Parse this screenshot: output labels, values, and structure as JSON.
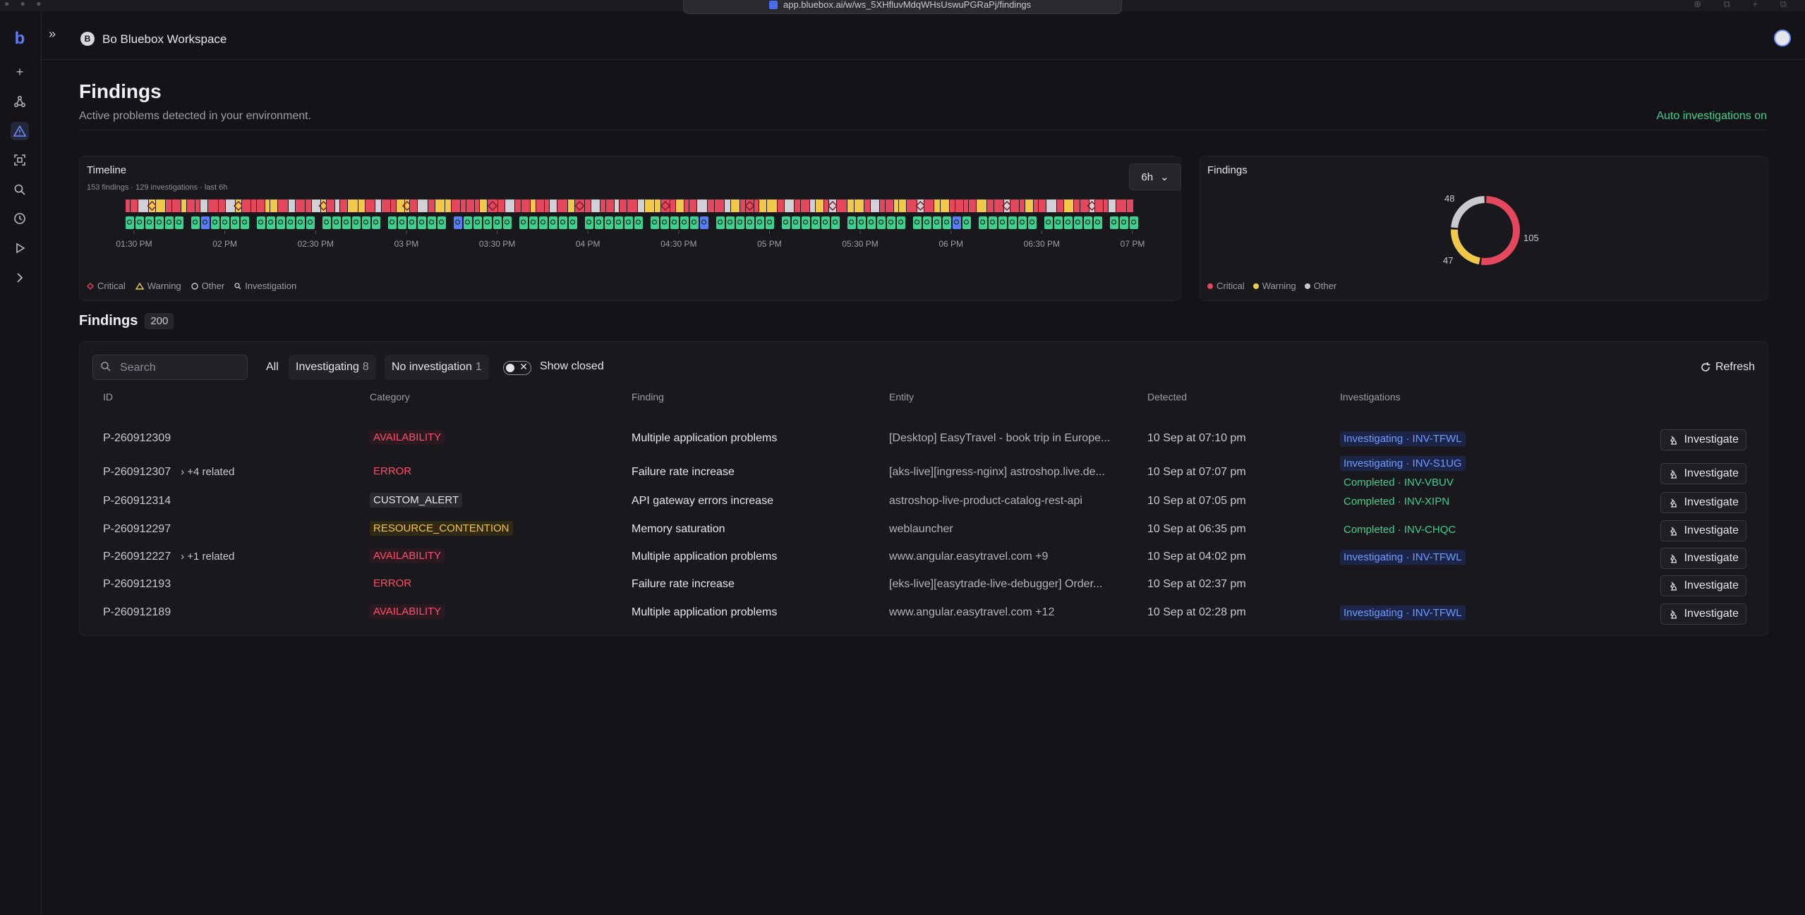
{
  "browser": {
    "url": "app.bluebox.ai/w/ws_5XHfluvMdqWHsUswuPGRaPj/findings"
  },
  "sidebar": {
    "items": [
      {
        "name": "logo",
        "icon": "bluebox-logo"
      },
      {
        "name": "new",
        "icon": "plus-icon"
      },
      {
        "name": "topology",
        "icon": "graph-icon"
      },
      {
        "name": "findings",
        "icon": "alert-triangle-icon",
        "active": true
      },
      {
        "name": "entities",
        "icon": "scan-icon"
      },
      {
        "name": "search",
        "icon": "search-icon"
      },
      {
        "name": "history",
        "icon": "clock-icon"
      },
      {
        "name": "runs",
        "icon": "play-icon"
      },
      {
        "name": "terminal",
        "icon": "chevron-right-icon"
      }
    ]
  },
  "header": {
    "workspace_initial": "B",
    "workspace_name": "Bo Bluebox Workspace"
  },
  "page": {
    "title": "Findings",
    "subtitle": "Active problems detected in your environment.",
    "auto_investigations": "Auto investigations on"
  },
  "timeline": {
    "title": "Timeline",
    "meta": "153 findings · 129 investigations · last 6h",
    "range": "6h",
    "ticks": [
      "01:30 PM",
      "02 PM",
      "02:30 PM",
      "03 PM",
      "03:30 PM",
      "04 PM",
      "04:30 PM",
      "05 PM",
      "05:30 PM",
      "06 PM",
      "06:30 PM",
      "07 PM"
    ],
    "legend": {
      "critical": "Critical",
      "warning": "Warning",
      "other": "Other",
      "investigation": "Investigation"
    },
    "colors": {
      "critical": "#e5485d",
      "warning": "#f0c94a",
      "other": "#d0d0d6",
      "investigation": "#3fcf8e",
      "investigation_active": "#5b7cff"
    }
  },
  "donut": {
    "title": "Findings",
    "chart_data": {
      "type": "pie",
      "categories": [
        "Critical",
        "Warning",
        "Other"
      ],
      "values": [
        105,
        47,
        48
      ],
      "colors": [
        "#e5485d",
        "#f0c94a",
        "#c9c9cf"
      ]
    },
    "labels": {
      "critical": "105",
      "warning": "47",
      "other": "48"
    },
    "legend": {
      "critical": "Critical",
      "warning": "Warning",
      "other": "Other"
    }
  },
  "findings": {
    "title": "Findings",
    "count": "200",
    "search_placeholder": "Search",
    "filters": {
      "all": "All",
      "investigating": "Investigating",
      "investigating_count": "8",
      "no_investigation": "No investigation",
      "no_investigation_count": "1"
    },
    "show_closed": "Show closed",
    "refresh": "Refresh",
    "columns": [
      "ID",
      "Category",
      "Finding",
      "Entity",
      "Detected",
      "Investigations"
    ],
    "investigate_label": "Investigate",
    "rows": [
      {
        "id": "P-260912309",
        "related": "",
        "category": "AVAILABILITY",
        "cat_class": "avail",
        "finding": "Multiple application problems",
        "entity": "[Desktop] EasyTravel - book trip in Europe...",
        "detected": "10 Sep at 07:10 pm",
        "investigations": [
          {
            "label": "Investigating · INV-TFWL",
            "status": "investigating"
          }
        ]
      },
      {
        "id": "P-260912307",
        "related": "+4 related",
        "category": "ERROR",
        "cat_class": "error",
        "finding": "Failure rate increase",
        "entity": "[aks-live][ingress-nginx] astroshop.live.de...",
        "detected": "10 Sep at 07:07 pm",
        "investigations": [
          {
            "label": "Investigating · INV-S1UG",
            "status": "investigating"
          },
          {
            "label": "Completed · INV-VBUV",
            "status": "completed"
          }
        ]
      },
      {
        "id": "P-260912314",
        "related": "",
        "category": "CUSTOM_ALERT",
        "cat_class": "custom",
        "finding": "API gateway errors increase",
        "entity": "astroshop-live-product-catalog-rest-api",
        "detected": "10 Sep at 07:05 pm",
        "investigations": [
          {
            "label": "Completed · INV-XIPN",
            "status": "completed"
          }
        ]
      },
      {
        "id": "P-260912297",
        "related": "",
        "category": "RESOURCE_CONTENTION",
        "cat_class": "resource",
        "finding": "Memory saturation",
        "entity": "weblauncher",
        "detected": "10 Sep at 06:35 pm",
        "investigations": [
          {
            "label": "Completed · INV-CHQC",
            "status": "completed"
          }
        ]
      },
      {
        "id": "P-260912227",
        "related": "+1 related",
        "category": "AVAILABILITY",
        "cat_class": "avail",
        "finding": "Multiple application problems",
        "entity": "www.angular.easytravel.com +9",
        "detected": "10 Sep at 04:02 pm",
        "investigations": [
          {
            "label": "Investigating · INV-TFWL",
            "status": "investigating"
          }
        ]
      },
      {
        "id": "P-260912193",
        "related": "",
        "category": "ERROR",
        "cat_class": "error",
        "finding": "Failure rate increase",
        "entity": "[eks-live][easytrade-live-debugger] Order...",
        "detected": "10 Sep at 02:37 pm",
        "investigations": []
      },
      {
        "id": "P-260912189",
        "related": "",
        "category": "AVAILABILITY",
        "cat_class": "avail",
        "finding": "Multiple application problems",
        "entity": "www.angular.easytravel.com +12",
        "detected": "10 Sep at 02:28 pm",
        "investigations": [
          {
            "label": "Investigating · INV-TFWL",
            "status": "investigating"
          }
        ]
      }
    ]
  }
}
